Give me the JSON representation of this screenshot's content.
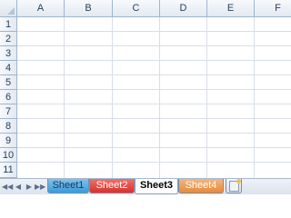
{
  "columns": [
    "A",
    "B",
    "C",
    "D",
    "E",
    "F"
  ],
  "rows": [
    "1",
    "2",
    "3",
    "4",
    "5",
    "6",
    "7",
    "8",
    "9",
    "10",
    "11"
  ],
  "sheet_tabs": [
    {
      "label": "Sheet1",
      "color": "#3a9ad9",
      "active": false
    },
    {
      "label": "Sheet2",
      "color": "#d6322d",
      "active": false
    },
    {
      "label": "Sheet3",
      "color": "#ffffff",
      "active": true
    },
    {
      "label": "Sheet4",
      "color": "#e8893c",
      "active": false
    }
  ],
  "nav_buttons": [
    "first-sheet",
    "previous-sheet",
    "next-sheet",
    "last-sheet"
  ],
  "new_sheet_icon": "insert-worksheet-icon"
}
